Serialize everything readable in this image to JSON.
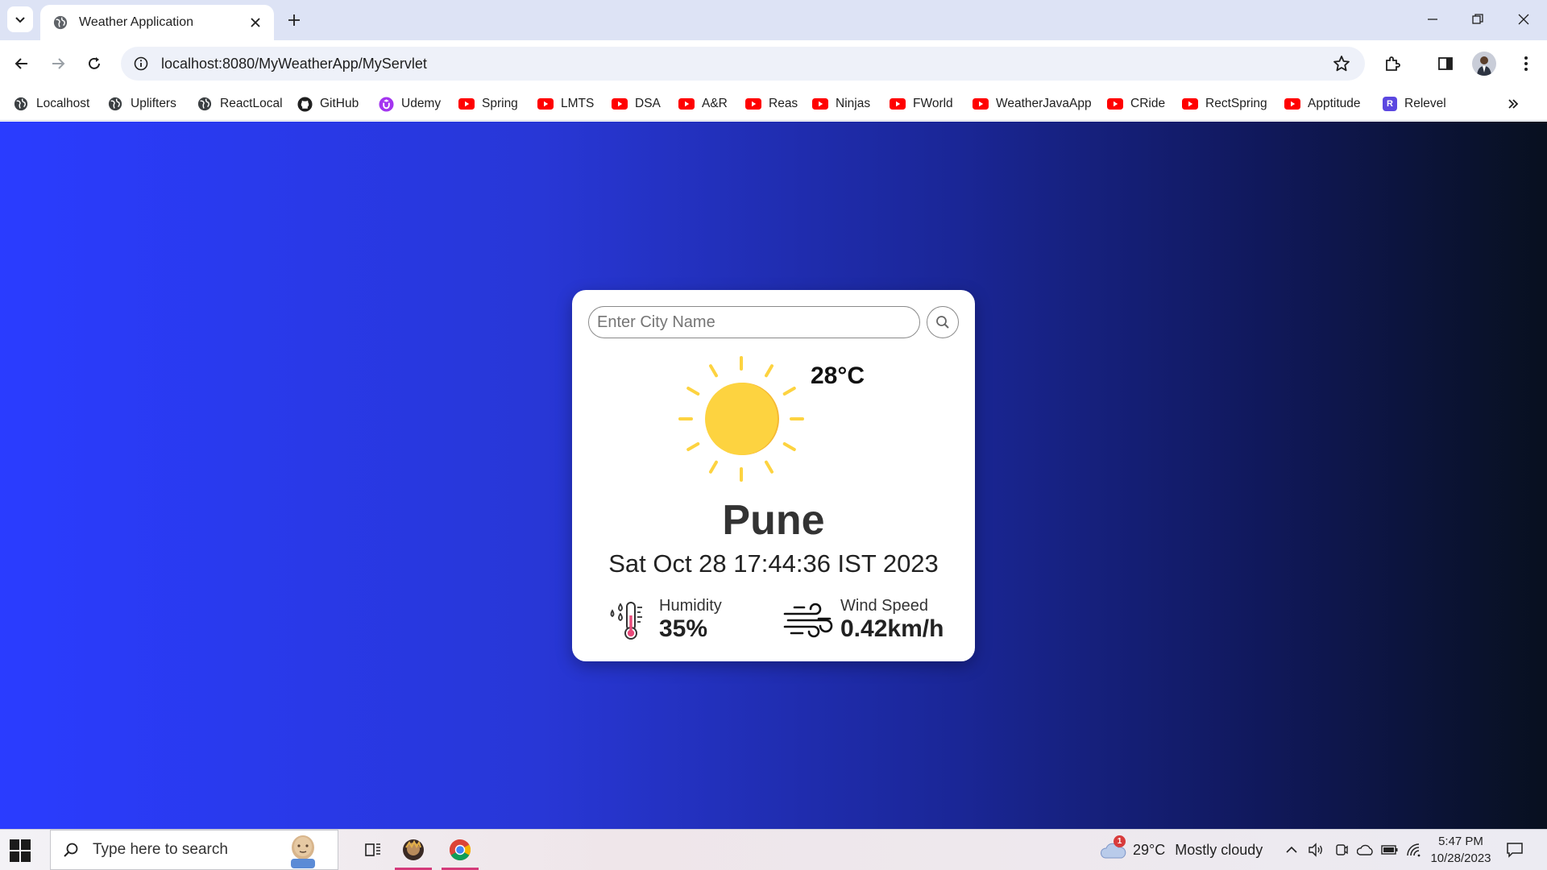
{
  "browser": {
    "tab": {
      "title": "Weather Application"
    },
    "address": {
      "url": "localhost:8080/MyWeatherApp/MyServlet"
    },
    "bookmarks": [
      {
        "label": "Localhost",
        "icon": "globe-icon"
      },
      {
        "label": "Uplifters",
        "icon": "globe-icon"
      },
      {
        "label": "ReactLocal",
        "icon": "globe-icon"
      },
      {
        "label": "GitHub",
        "icon": "github-icon"
      },
      {
        "label": "Udemy",
        "icon": "udemy-icon"
      },
      {
        "label": "Spring",
        "icon": "youtube-icon"
      },
      {
        "label": "LMTS",
        "icon": "youtube-icon"
      },
      {
        "label": "DSA",
        "icon": "youtube-icon"
      },
      {
        "label": "A&R",
        "icon": "youtube-icon"
      },
      {
        "label": "Reas",
        "icon": "youtube-icon"
      },
      {
        "label": "Ninjas",
        "icon": "youtube-icon"
      },
      {
        "label": "FWorld",
        "icon": "youtube-icon"
      },
      {
        "label": "WeatherJavaApp",
        "icon": "youtube-icon"
      },
      {
        "label": "CRide",
        "icon": "youtube-icon"
      },
      {
        "label": "RectSpring",
        "icon": "youtube-icon"
      },
      {
        "label": "Apptitude",
        "icon": "youtube-icon"
      },
      {
        "label": "Relevel",
        "icon": "relevel-icon",
        "icon_letter": "R"
      }
    ]
  },
  "weather": {
    "search_placeholder": "Enter City Name",
    "search_value": "",
    "temperature": "28°C",
    "city": "Pune",
    "datetime": "Sat Oct 28 17:44:36 IST 2023",
    "humidity_label": "Humidity",
    "humidity_value": "35%",
    "wind_label": "Wind Speed",
    "wind_value": "0.42km/h",
    "condition_icon": "sun-icon"
  },
  "taskbar": {
    "search_placeholder": "Type here to search",
    "weather_temp": "29°C",
    "weather_desc": "Mostly cloudy",
    "weather_badge": "1",
    "time": "5:47 PM",
    "date": "10/28/2023"
  },
  "colors": {
    "youtube_red": "#ff0000",
    "udemy_purple": "#a435f0",
    "relevel_purple": "#5b47e0",
    "sun_yellow": "#fdd340",
    "sun_shade": "#f6b933",
    "taskbar_accent": "#d43a7a"
  }
}
